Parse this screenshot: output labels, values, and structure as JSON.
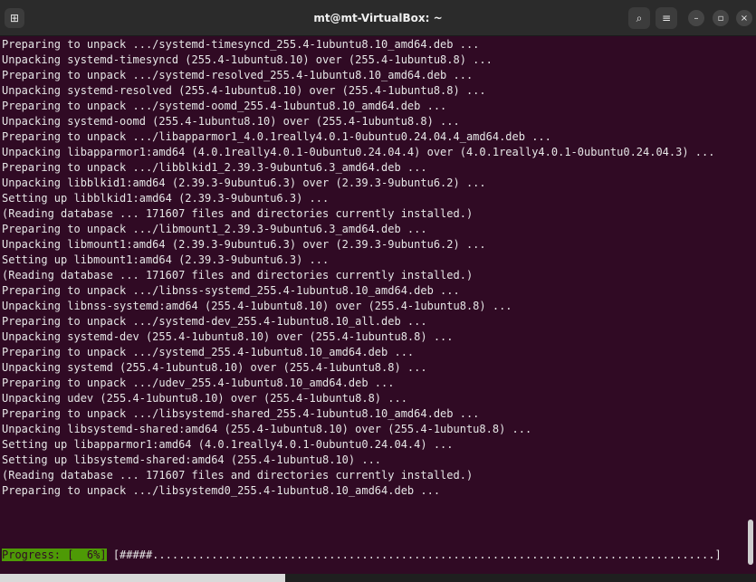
{
  "window": {
    "title": "mt@mt-VirtualBox: ~"
  },
  "icons": {
    "new_tab": "terminal-tab-icon",
    "search": "search-icon",
    "menu": "hamburger-menu-icon",
    "minimize": "minimize-icon",
    "maximize": "maximize-icon",
    "close": "close-icon"
  },
  "colors": {
    "terminal_bg": "#300a24",
    "terminal_text": "#e6e6e6",
    "progress_highlight": "#4e9a06",
    "titlebar_bg": "#2b2b2b"
  },
  "terminal": {
    "lines": [
      "Preparing to unpack .../systemd-timesyncd_255.4-1ubuntu8.10_amd64.deb ...",
      "Unpacking systemd-timesyncd (255.4-1ubuntu8.10) over (255.4-1ubuntu8.8) ...",
      "Preparing to unpack .../systemd-resolved_255.4-1ubuntu8.10_amd64.deb ...",
      "Unpacking systemd-resolved (255.4-1ubuntu8.10) over (255.4-1ubuntu8.8) ...",
      "Preparing to unpack .../systemd-oomd_255.4-1ubuntu8.10_amd64.deb ...",
      "Unpacking systemd-oomd (255.4-1ubuntu8.10) over (255.4-1ubuntu8.8) ...",
      "Preparing to unpack .../libapparmor1_4.0.1really4.0.1-0ubuntu0.24.04.4_amd64.deb ...",
      "Unpacking libapparmor1:amd64 (4.0.1really4.0.1-0ubuntu0.24.04.4) over (4.0.1really4.0.1-0ubuntu0.24.04.3) ...",
      "Preparing to unpack .../libblkid1_2.39.3-9ubuntu6.3_amd64.deb ...",
      "Unpacking libblkid1:amd64 (2.39.3-9ubuntu6.3) over (2.39.3-9ubuntu6.2) ...",
      "Setting up libblkid1:amd64 (2.39.3-9ubuntu6.3) ...",
      "(Reading database ... 171607 files and directories currently installed.)",
      "Preparing to unpack .../libmount1_2.39.3-9ubuntu6.3_amd64.deb ...",
      "Unpacking libmount1:amd64 (2.39.3-9ubuntu6.3) over (2.39.3-9ubuntu6.2) ...",
      "Setting up libmount1:amd64 (2.39.3-9ubuntu6.3) ...",
      "(Reading database ... 171607 files and directories currently installed.)",
      "Preparing to unpack .../libnss-systemd_255.4-1ubuntu8.10_amd64.deb ...",
      "Unpacking libnss-systemd:amd64 (255.4-1ubuntu8.10) over (255.4-1ubuntu8.8) ...",
      "Preparing to unpack .../systemd-dev_255.4-1ubuntu8.10_all.deb ...",
      "Unpacking systemd-dev (255.4-1ubuntu8.10) over (255.4-1ubuntu8.8) ...",
      "Preparing to unpack .../systemd_255.4-1ubuntu8.10_amd64.deb ...",
      "Unpacking systemd (255.4-1ubuntu8.10) over (255.4-1ubuntu8.8) ...",
      "Preparing to unpack .../udev_255.4-1ubuntu8.10_amd64.deb ...",
      "Unpacking udev (255.4-1ubuntu8.10) over (255.4-1ubuntu8.8) ...",
      "Preparing to unpack .../libsystemd-shared_255.4-1ubuntu8.10_amd64.deb ...",
      "Unpacking libsystemd-shared:amd64 (255.4-1ubuntu8.10) over (255.4-1ubuntu8.8) ...",
      "Setting up libapparmor1:amd64 (4.0.1really4.0.1-0ubuntu0.24.04.4) ...",
      "Setting up libsystemd-shared:amd64 (255.4-1ubuntu8.10) ...",
      "(Reading database ... 171607 files and directories currently installed.)",
      "Preparing to unpack .../libsystemd0_255.4-1ubuntu8.10_amd64.deb ..."
    ],
    "progress_label": "Progress: [  6%]",
    "progress_percent": 6,
    "progress_bar": " [#####......................................................................................]"
  }
}
